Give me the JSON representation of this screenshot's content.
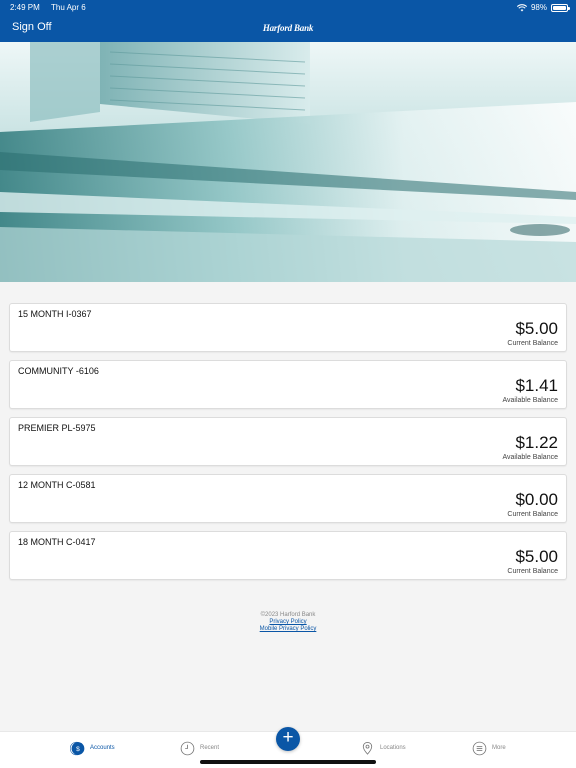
{
  "status_bar": {
    "time": "2:49 PM",
    "date": "Thu Apr 6",
    "battery": "98%",
    "battery_level": 0.98
  },
  "header": {
    "sign_off": "Sign Off",
    "brand": "Harford Bank"
  },
  "accounts": [
    {
      "name": "15 MONTH I-0367",
      "amount": "$5.00",
      "label": "Current Balance"
    },
    {
      "name": "COMMUNITY -6106",
      "amount": "$1.41",
      "label": "Available Balance"
    },
    {
      "name": "PREMIER PL-5975",
      "amount": "$1.22",
      "label": "Available Balance"
    },
    {
      "name": "12 MONTH C-0581",
      "amount": "$0.00",
      "label": "Current Balance"
    },
    {
      "name": "18 MONTH C-0417",
      "amount": "$5.00",
      "label": "Current Balance"
    }
  ],
  "footer": {
    "copyright": "©2023 Harford Bank",
    "privacy": "Privacy Policy",
    "mobile_privacy": "Mobile Privacy Policy"
  },
  "tabs": {
    "accounts": "Accounts",
    "recent": "Recent",
    "add": "+",
    "locations": "Locations",
    "more": "More"
  },
  "icons": {
    "wifi": "wifi-icon",
    "battery": "battery-icon",
    "accounts": "dollar-circle-icon",
    "recent": "clock-icon",
    "add": "plus-icon",
    "locations": "map-pin-icon",
    "more": "menu-lines-icon"
  },
  "colors": {
    "brand_blue": "#0a56a6",
    "background": "#f4f4f4"
  }
}
